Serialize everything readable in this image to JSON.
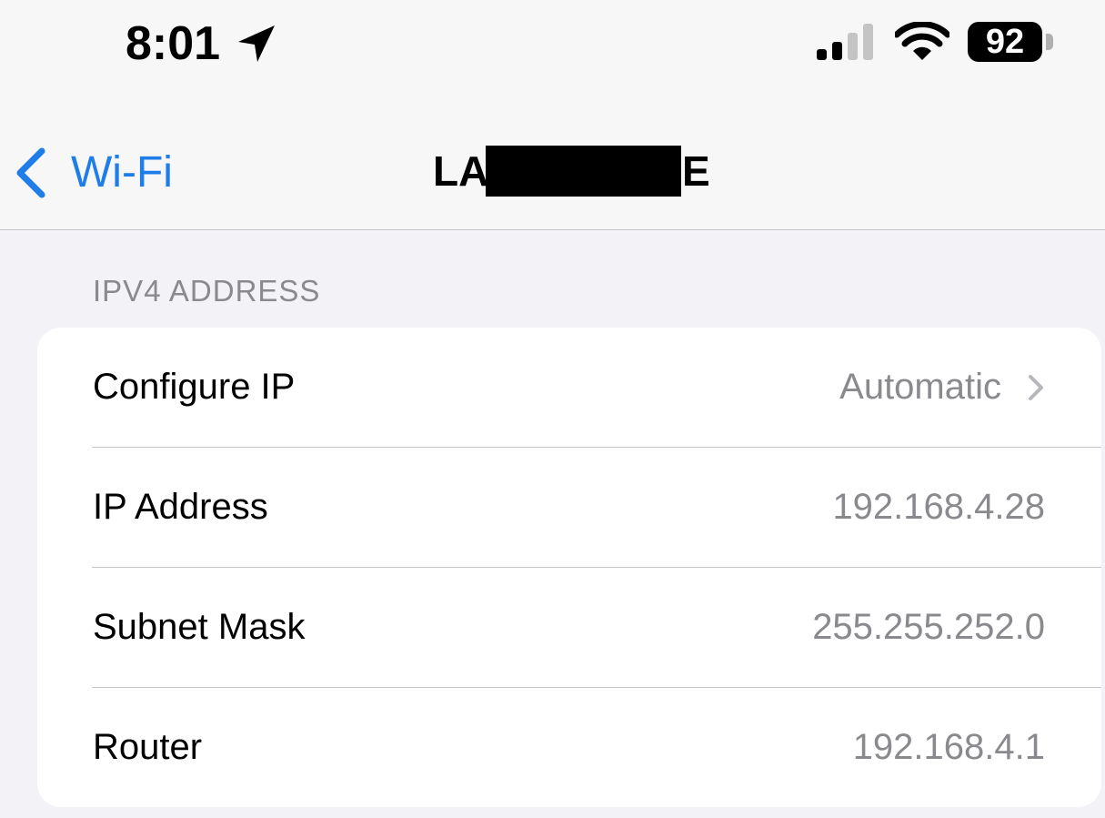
{
  "status_bar": {
    "time": "8:01",
    "battery": "92",
    "location_icon": "location-arrow-icon",
    "signal_icon": "cellular-signal-icon",
    "wifi_icon": "wifi-icon"
  },
  "nav": {
    "back_label": "Wi-Fi",
    "back_icon": "chevron-left-icon",
    "title_start": "LA",
    "title_end": "E"
  },
  "section": {
    "header": "IPV4 ADDRESS",
    "rows": [
      {
        "label": "Configure IP",
        "value": "Automatic",
        "chevron": true
      },
      {
        "label": "IP Address",
        "value": "192.168.4.28"
      },
      {
        "label": "Subnet Mask",
        "value": "255.255.252.0"
      },
      {
        "label": "Router",
        "value": "192.168.4.1"
      }
    ]
  },
  "colors": {
    "accent": "#1e7de8",
    "background": "#f2f2f7",
    "secondary_text": "#8a8a8e"
  }
}
